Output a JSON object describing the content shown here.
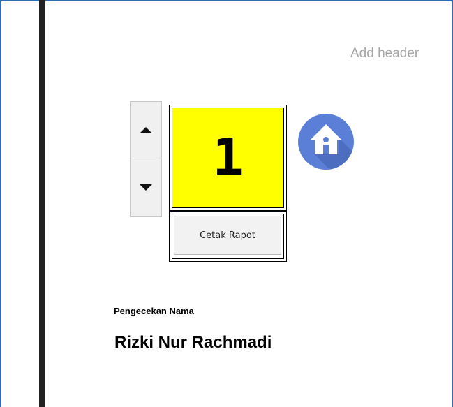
{
  "header": {
    "placeholder": "Add header"
  },
  "spinner": {
    "up_icon": "triangle-up",
    "down_icon": "triangle-down"
  },
  "counter": {
    "value": "1",
    "background": "#ffff00"
  },
  "print": {
    "label": "Cetak Rapot"
  },
  "home": {
    "icon": "home-icon",
    "color": "#5b7fd6"
  },
  "name_check": {
    "label": "Pengecekan Nama",
    "value": "Rizki Nur Rachmadi"
  }
}
